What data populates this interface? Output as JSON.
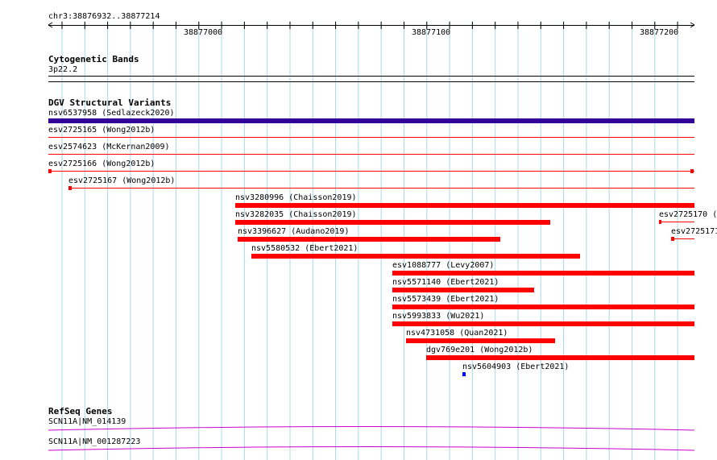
{
  "ruler": {
    "region": "chr3:38876932..38877214",
    "ticks": [
      "38877000",
      "38877100",
      "38877200"
    ]
  },
  "cytoband": {
    "title": "Cytogenetic Bands",
    "band": "3p22.2"
  },
  "dgv": {
    "title": "DGV Structural Variants",
    "features": [
      {
        "name": "nsv6537958 (Sedlazeck2020)",
        "kind": "loss-dark",
        "color": "#330099"
      },
      {
        "name": "esv2725165 (Wong2012b)",
        "kind": "thin",
        "color": "#ff0000"
      },
      {
        "name": "esv2574623 (McKernan2009)",
        "kind": "thin",
        "color": "#ff0000"
      },
      {
        "name": "esv2725166 (Wong2012b)",
        "kind": "thin-capped",
        "color": "#ff0000"
      },
      {
        "name": "esv2725167 (Wong2012b)",
        "kind": "thin-left-cap",
        "color": "#ff0000"
      },
      {
        "name": "nsv3280996 (Chaisson2019)",
        "kind": "thick",
        "color": "#ff0000"
      },
      {
        "name": "nsv3282035 (Chaisson2019)",
        "kind": "thick",
        "color": "#ff0000"
      },
      {
        "name": "esv2725170 (",
        "kind": "thin-left-cap",
        "color": "#ff0000"
      },
      {
        "name": "nsv3396627 (Audano2019)",
        "kind": "thick",
        "color": "#ff0000"
      },
      {
        "name": "esv2725171",
        "kind": "thin-left-cap",
        "color": "#ff0000"
      },
      {
        "name": "nsv5580532 (Ebert2021)",
        "kind": "thick",
        "color": "#ff0000"
      },
      {
        "name": "esv1088777 (Levy2007)",
        "kind": "thick",
        "color": "#ff0000"
      },
      {
        "name": "nsv5571140 (Ebert2021)",
        "kind": "thick",
        "color": "#ff0000"
      },
      {
        "name": "nsv5573439 (Ebert2021)",
        "kind": "thick",
        "color": "#ff0000"
      },
      {
        "name": "nsv5993833 (Wu2021)",
        "kind": "thick",
        "color": "#ff0000"
      },
      {
        "name": "nsv4731058 (Quan2021)",
        "kind": "thick",
        "color": "#ff0000"
      },
      {
        "name": "dgv769e201 (Wong2012b)",
        "kind": "thick",
        "color": "#ff0000"
      },
      {
        "name": "nsv5604903 (Ebert2021)",
        "kind": "small",
        "color": "#0000ff"
      }
    ]
  },
  "refseq": {
    "title": "RefSeq Genes",
    "genes": [
      {
        "name": "SCN11A|NM_014139",
        "color": "#cc00cc"
      },
      {
        "name": "SCN11A|NM_001287223",
        "color": "#cc00cc"
      }
    ]
  },
  "colors": {
    "gridline": "#a8d8e8",
    "loss": "#ff0000",
    "dark": "#330099",
    "gain": "#0000ff",
    "gene": "#cc00cc"
  }
}
